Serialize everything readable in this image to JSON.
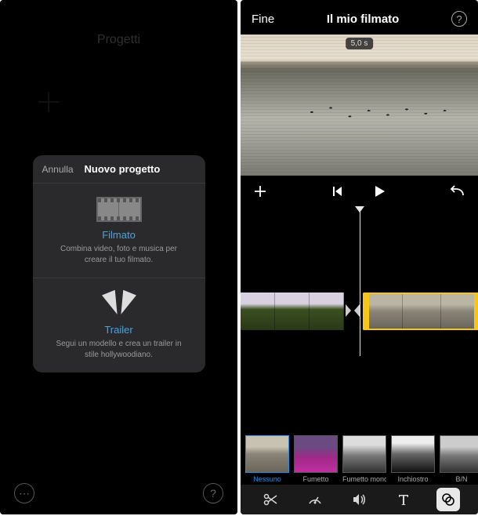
{
  "left": {
    "header_title": "Progetti",
    "sheet": {
      "cancel": "Annulla",
      "title": "Nuovo progetto",
      "items": [
        {
          "title": "Filmato",
          "desc": "Combina video, foto e musica per creare il tuo filmato."
        },
        {
          "title": "Trailer",
          "desc": "Segui un modello e crea un trailer in stile hollywoodiano."
        }
      ]
    },
    "more_glyph": "⋯",
    "help_glyph": "?"
  },
  "right": {
    "done": "Fine",
    "title": "Il mio filmato",
    "help_glyph": "?",
    "time_badge": "5,0 s",
    "filters": [
      {
        "label": "Nessuno",
        "cls": "ft-nessuno",
        "selected": true
      },
      {
        "label": "Fumetto",
        "cls": "ft-fumetto",
        "selected": false
      },
      {
        "label": "Fumetto mono",
        "cls": "ft-mono",
        "selected": false
      },
      {
        "label": "Inchiostro",
        "cls": "ft-ink",
        "selected": false
      },
      {
        "label": "B/N",
        "cls": "ft-bn",
        "selected": false
      }
    ]
  }
}
